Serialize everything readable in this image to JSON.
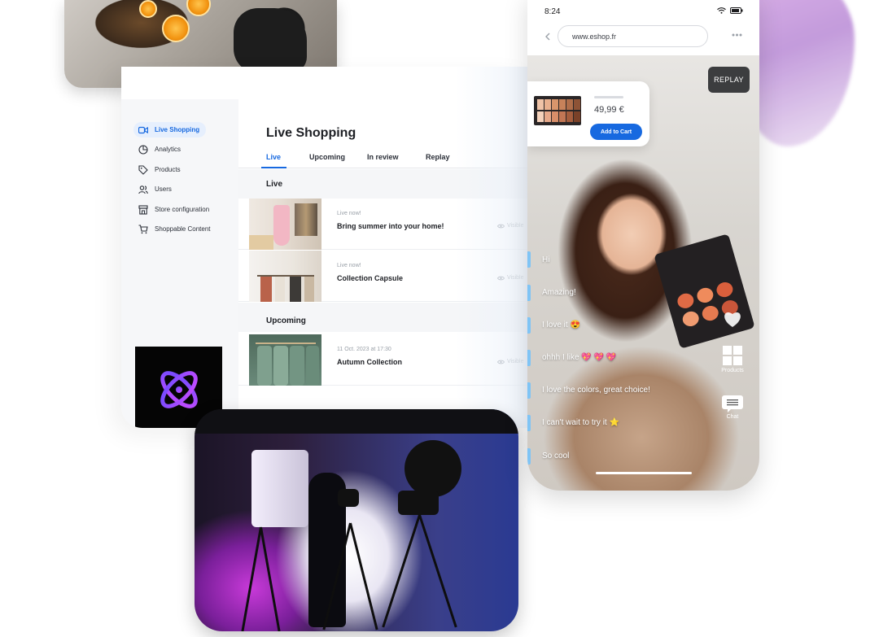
{
  "dashboard": {
    "title": "Live Shopping",
    "nav": [
      {
        "label": "Live Shopping",
        "icon": "video-camera-icon"
      },
      {
        "label": "Analytics",
        "icon": "pie-chart-icon"
      },
      {
        "label": "Products",
        "icon": "tag-icon"
      },
      {
        "label": "Users",
        "icon": "users-icon"
      },
      {
        "label": "Store configuration",
        "icon": "store-icon"
      },
      {
        "label": "Shoppable Content",
        "icon": "cart-icon"
      }
    ],
    "tabs": [
      "Live",
      "Upcoming",
      "In review",
      "Replay"
    ],
    "sections": {
      "live": {
        "label": "Live",
        "events": [
          {
            "status": "Live now!",
            "title": "Bring summer into your home!",
            "visibility": "Visible"
          },
          {
            "status": "Live now!",
            "title": "Collection Capsule",
            "visibility": "Visible"
          }
        ]
      },
      "upcoming": {
        "label": "Upcoming",
        "events": [
          {
            "status": "11 Oct. 2023 at 17:30",
            "title": "Autumn Collection",
            "visibility": "Visible"
          }
        ]
      }
    }
  },
  "phone": {
    "time": "8:24",
    "url": "www.eshop.fr",
    "replay_label": "REPLAY",
    "product": {
      "price": "49,99 €",
      "cta": "Add to Cart"
    },
    "chat": [
      {
        "text": "Hi",
        "emoji": ""
      },
      {
        "text": "Amazing!",
        "emoji": ""
      },
      {
        "text": "I love it",
        "emoji": "😍"
      },
      {
        "text": "ohhh I like",
        "emoji": "💖 💖 💖"
      },
      {
        "text": "I love the colors, great choice!",
        "emoji": ""
      },
      {
        "text": "I can't wait to try it",
        "emoji": "⭐"
      },
      {
        "text": "So cool",
        "emoji": ""
      }
    ],
    "actions": {
      "products": "Products",
      "chat": "Chat"
    }
  },
  "colors": {
    "accent": "#1769e0",
    "logo_gradient_start": "#6f4bff",
    "logo_gradient_end": "#c84bff"
  }
}
